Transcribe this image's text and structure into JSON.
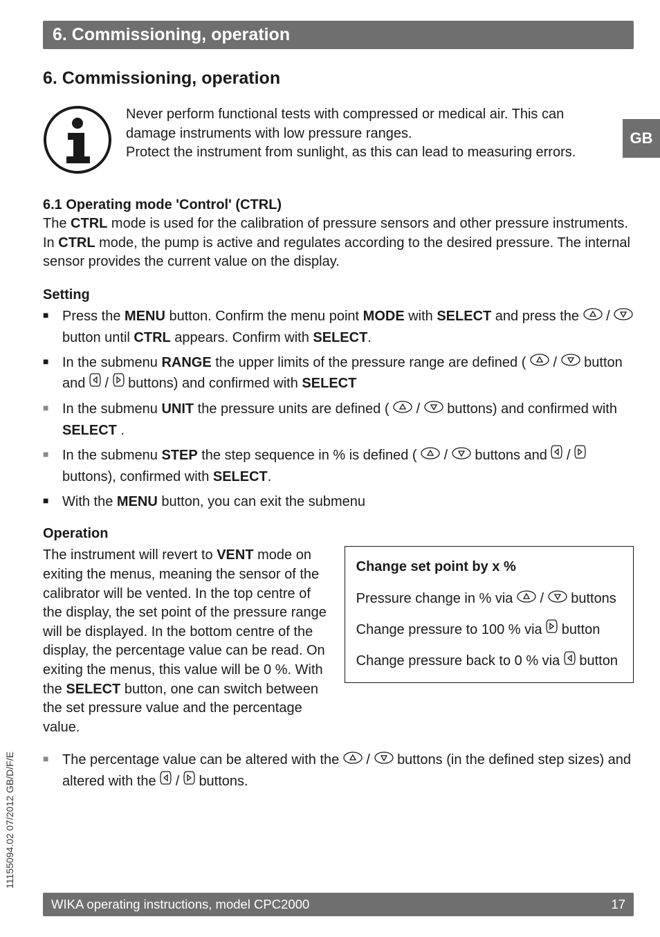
{
  "header": {
    "bar_title": "6. Commissioning, operation"
  },
  "section_title": "6. Commissioning, operation",
  "lang_tab": "GB",
  "info_notice": "Never perform functional tests with compressed or medical air. This can damage instruments with low pressure ranges.\nProtect the instrument from sunlight, as this can lead to measuring errors.",
  "ctrl": {
    "heading": "6.1 Operating mode 'Control' (CTRL)",
    "para_pre": "The ",
    "ctrl_word": "CTRL",
    "para_mid1": " mode is used for the calibration of pressure sensors and other pressure instruments. In ",
    "para_mid2": " mode, the pump is active and regulates according to the desired pressure. The internal sensor provides the current value on the display."
  },
  "setting": {
    "heading": "Setting",
    "items": [
      {
        "pre": "Press the ",
        "b1": "MENU",
        "mid1": " button. Confirm the menu point ",
        "b2": "MODE",
        "mid2": " with ",
        "b3": "SELECT",
        "mid3": " and press the ",
        "icons": "updown",
        "mid4": " button until ",
        "b4": "CTRL",
        "mid5": " appears. Confirm with ",
        "b5": "SELECT",
        "tail": "."
      },
      {
        "pre": "In the submenu ",
        "b1": "RANGE",
        "mid1": " the upper limits of the pressure range are defined ( ",
        "icons": "updown_and_leftright",
        "mid2": " buttons) and confirmed with ",
        "b2": "SELECT",
        "tail": ""
      },
      {
        "pre": "In the submenu ",
        "b1": "UNIT",
        "mid1": " the pressure units are defined ( ",
        "icons": "updown",
        "mid2": " buttons) and confirmed with ",
        "b2": "SELECT",
        "tail": " ."
      },
      {
        "pre": "In the submenu ",
        "b1": "STEP",
        "mid1": " the step sequence in % is defined ( ",
        "icons": "updown_and_leftright",
        "mid2": " buttons), confirmed with ",
        "b2": "SELECT",
        "tail": "."
      },
      {
        "pre": "With the ",
        "b1": "MENU",
        "mid1": " button, you can exit the submenu",
        "tail": ""
      }
    ]
  },
  "operation": {
    "heading": "Operation",
    "para_pre": "The instrument will revert to ",
    "vent": "VENT",
    "para_mid1": " mode on exiting the menus, meaning the sensor of the calibrator will be vented. In the top centre of the display, the set point of the pressure range will be displayed. In the bottom centre of the display, the percentage value can be read. On exiting the menus, this value will be 0 %. With the ",
    "select": "SELECT",
    "para_tail": " button, one can switch between the set pressure value and the percentage value."
  },
  "box": {
    "title": "Change set point by x %",
    "line1_pre": "Pressure change in % via ",
    "line1_post": " buttons",
    "line2_pre": "Change pressure to 100 % via ",
    "line2_post": " button",
    "line3_pre": "Change pressure back to 0 % via ",
    "line3_post": " button"
  },
  "last_bullet": {
    "pre": "The percentage value can be altered with the ",
    "mid1": " buttons (in the defined step sizes) and altered with the ",
    "tail": " buttons."
  },
  "side_text": "11155094.02 07/2012 GB/D/F/E",
  "footer": {
    "left": "WIKA operating instructions, model CPC2000",
    "right": "17"
  },
  "icons": {
    "up": "up-oval-icon",
    "down": "down-oval-icon",
    "left": "left-rect-icon",
    "right": "right-rect-icon"
  }
}
